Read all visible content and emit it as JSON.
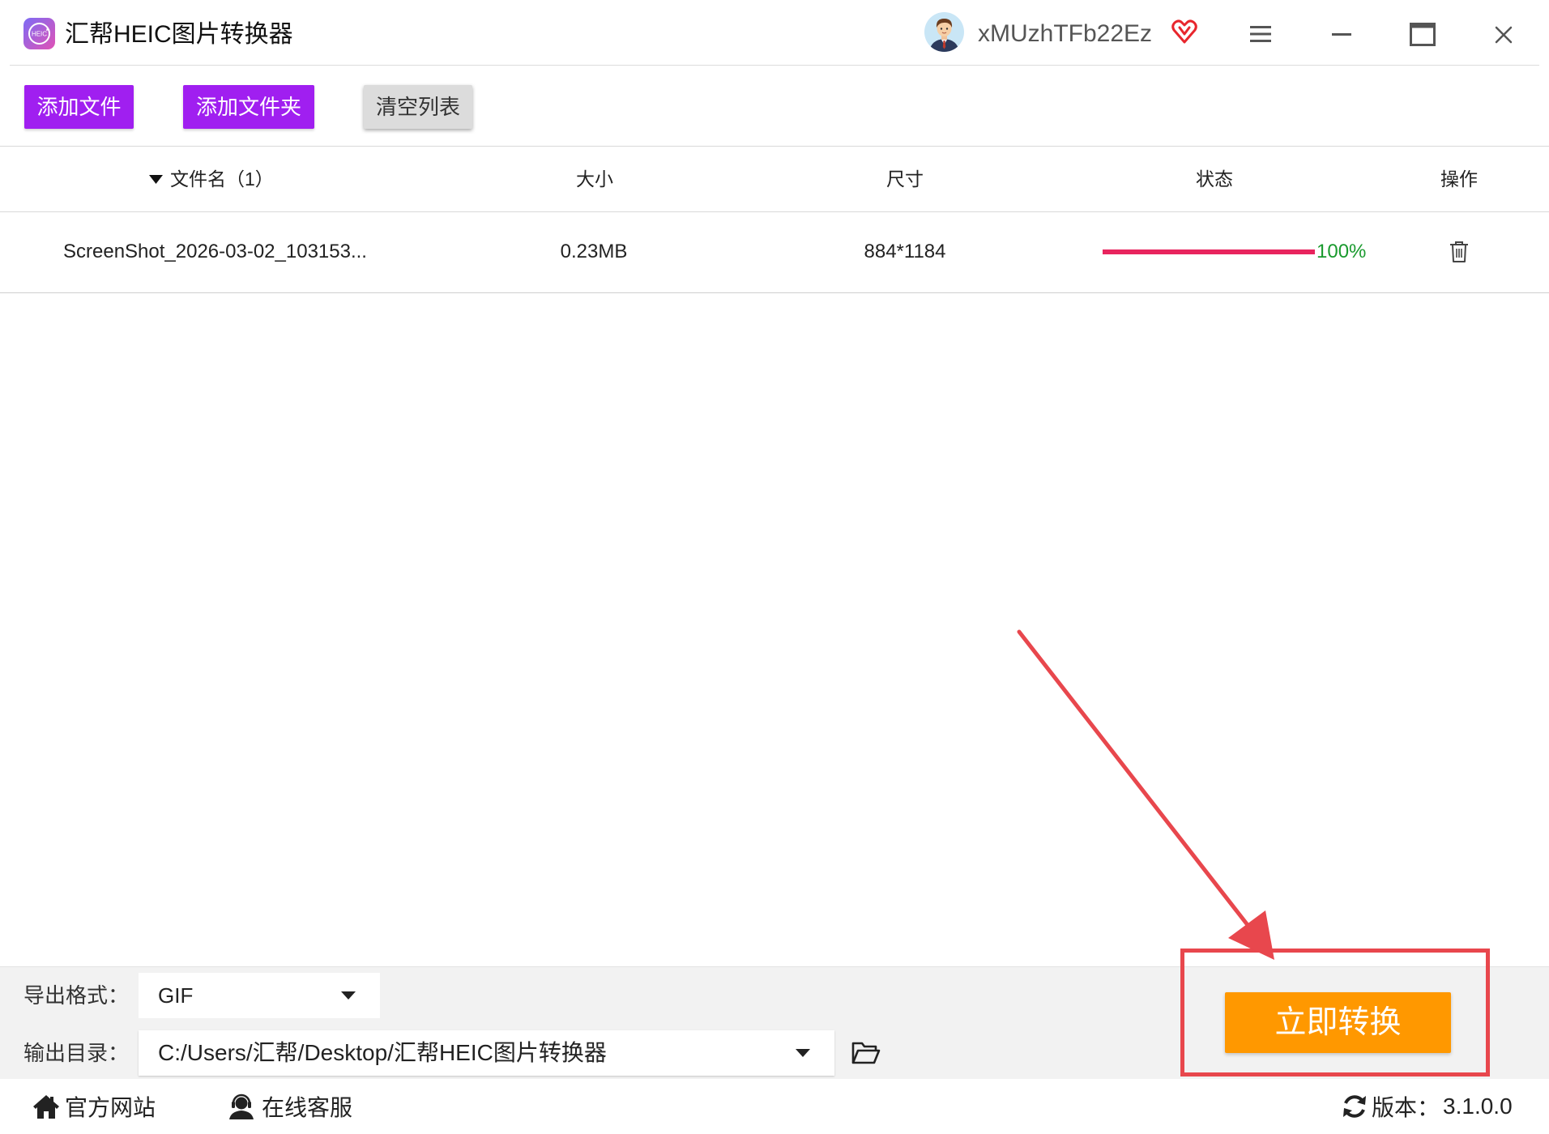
{
  "app": {
    "title": "汇帮HEIC图片转换器",
    "logo_text": "HEIC",
    "logo_icon": "heic-logo-icon"
  },
  "user": {
    "name": "xMUzhTFb22Ez",
    "avatar_icon": "user-avatar-icon",
    "vip_icon": "vip-heart-icon"
  },
  "window_controls": {
    "menu_icon": "hamburger-menu-icon",
    "minimize_icon": "minimize-icon",
    "maximize_icon": "maximize-icon",
    "close_icon": "close-icon"
  },
  "toolbar": {
    "add_file_label": "添加文件",
    "add_folder_label": "添加文件夹",
    "clear_list_label": "清空列表"
  },
  "table": {
    "sort_icon": "sort-desc-icon",
    "headers": {
      "filename": "文件名（1）",
      "size": "大小",
      "dimensions": "尺寸",
      "status": "状态",
      "actions": "操作"
    },
    "rows": [
      {
        "filename": "ScreenShot_2026-03-02_103153...",
        "size": "0.23MB",
        "dimensions": "884*1184",
        "progress": 100,
        "progress_label": "100%",
        "action_icon": "trash-icon"
      }
    ]
  },
  "export": {
    "format_label": "导出格式：",
    "format_value": "GIF",
    "output_label": "输出目录：",
    "output_value": "C:/Users/汇帮/Desktop/汇帮HEIC图片转换器",
    "dropdown_icon": "caret-down-icon",
    "browse_icon": "folder-open-icon"
  },
  "convert": {
    "label": "立即转换"
  },
  "footer": {
    "website_icon": "home-icon",
    "website_label": "官方网站",
    "support_icon": "customer-service-icon",
    "support_label": "在线客服",
    "version_icon": "refresh-icon",
    "version_label": "版本：",
    "version_value": "3.1.0.0"
  },
  "colors": {
    "brand_purple": "#a01ff0",
    "convert_orange": "#ff9800",
    "progress_bar": "#e8245e",
    "progress_text": "#1a9a2e",
    "annotation_red": "#e8474d",
    "vip_red": "#e8262d"
  }
}
